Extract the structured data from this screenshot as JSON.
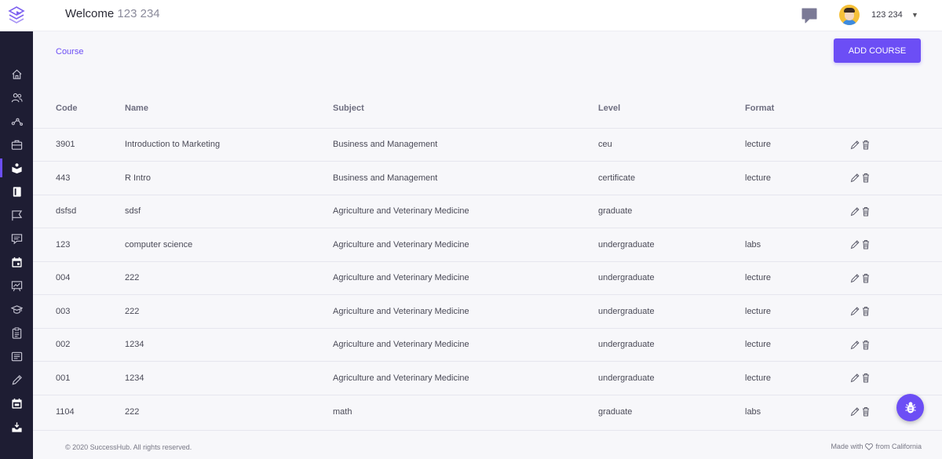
{
  "header": {
    "welcome_label": "Welcome",
    "user_short": "123 234",
    "user_name": "123 234"
  },
  "breadcrumb": {
    "label": "Course"
  },
  "actions": {
    "add_course_label": "ADD COURSE"
  },
  "table": {
    "columns": {
      "code": "Code",
      "name": "Name",
      "subject": "Subject",
      "level": "Level",
      "format": "Format"
    },
    "rows": [
      {
        "code": "3901",
        "name": "Introduction to Marketing",
        "subject": "Business and Management",
        "level": "ceu",
        "format": "lecture"
      },
      {
        "code": "443",
        "name": "R Intro",
        "subject": "Business and Management",
        "level": "certificate",
        "format": "lecture"
      },
      {
        "code": "dsfsd",
        "name": "sdsf",
        "subject": "Agriculture and Veterinary Medicine",
        "level": "graduate",
        "format": ""
      },
      {
        "code": "123",
        "name": "computer science",
        "subject": "Agriculture and Veterinary Medicine",
        "level": "undergraduate",
        "format": "labs"
      },
      {
        "code": "004",
        "name": "222",
        "subject": "Agriculture and Veterinary Medicine",
        "level": "undergraduate",
        "format": "lecture"
      },
      {
        "code": "003",
        "name": "222",
        "subject": "Agriculture and Veterinary Medicine",
        "level": "undergraduate",
        "format": "lecture"
      },
      {
        "code": "002",
        "name": "1234",
        "subject": "Agriculture and Veterinary Medicine",
        "level": "undergraduate",
        "format": "lecture"
      },
      {
        "code": "001",
        "name": "1234",
        "subject": "Agriculture and Veterinary Medicine",
        "level": "undergraduate",
        "format": "lecture"
      },
      {
        "code": "1104",
        "name": "222",
        "subject": "math",
        "level": "graduate",
        "format": "labs"
      }
    ]
  },
  "footer": {
    "copyright": "© 2020 SuccessHub. All rights reserved.",
    "made_with": "Made with",
    "from": "from California"
  },
  "sidebar": {
    "items": [
      {
        "icon": "home-icon"
      },
      {
        "icon": "users-icon"
      },
      {
        "icon": "share-icon"
      },
      {
        "icon": "briefcase-icon"
      },
      {
        "icon": "course-icon"
      },
      {
        "icon": "book-icon"
      },
      {
        "icon": "flag-icon"
      },
      {
        "icon": "message-icon"
      },
      {
        "icon": "calendar-icon"
      },
      {
        "icon": "presentation-icon"
      },
      {
        "icon": "graduation-cap-icon"
      },
      {
        "icon": "clipboard-icon"
      },
      {
        "icon": "newspaper-icon"
      },
      {
        "icon": "pencil-icon"
      },
      {
        "icon": "calendar-event-icon"
      },
      {
        "icon": "inbox-icon"
      }
    ],
    "active_index": 4
  },
  "colors": {
    "accent": "#6c4ef5",
    "sidebar_bg": "#1e1d33",
    "page_bg": "#f7f7fa"
  }
}
